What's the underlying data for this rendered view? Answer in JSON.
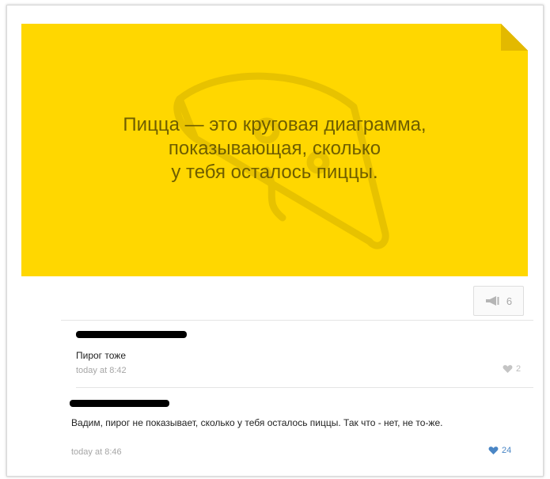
{
  "post": {
    "text_lines": [
      "Пицца — это круговая диаграмма,",
      "показывающая, сколько",
      "у тебя осталось пиццы."
    ],
    "share_count": "6",
    "card_color": "#ffd700"
  },
  "comments": [
    {
      "text": "Пирог тоже",
      "time": "today at 8:42",
      "likes": "2",
      "liked": false
    },
    {
      "text": "Вадим, пирог не показывает, сколько у тебя осталось пиццы. Так что - нет, не то-же.",
      "time": "today at 8:46",
      "likes": "24",
      "liked": true
    }
  ],
  "icons": {
    "share": "megaphone-icon",
    "like": "heart-icon"
  }
}
